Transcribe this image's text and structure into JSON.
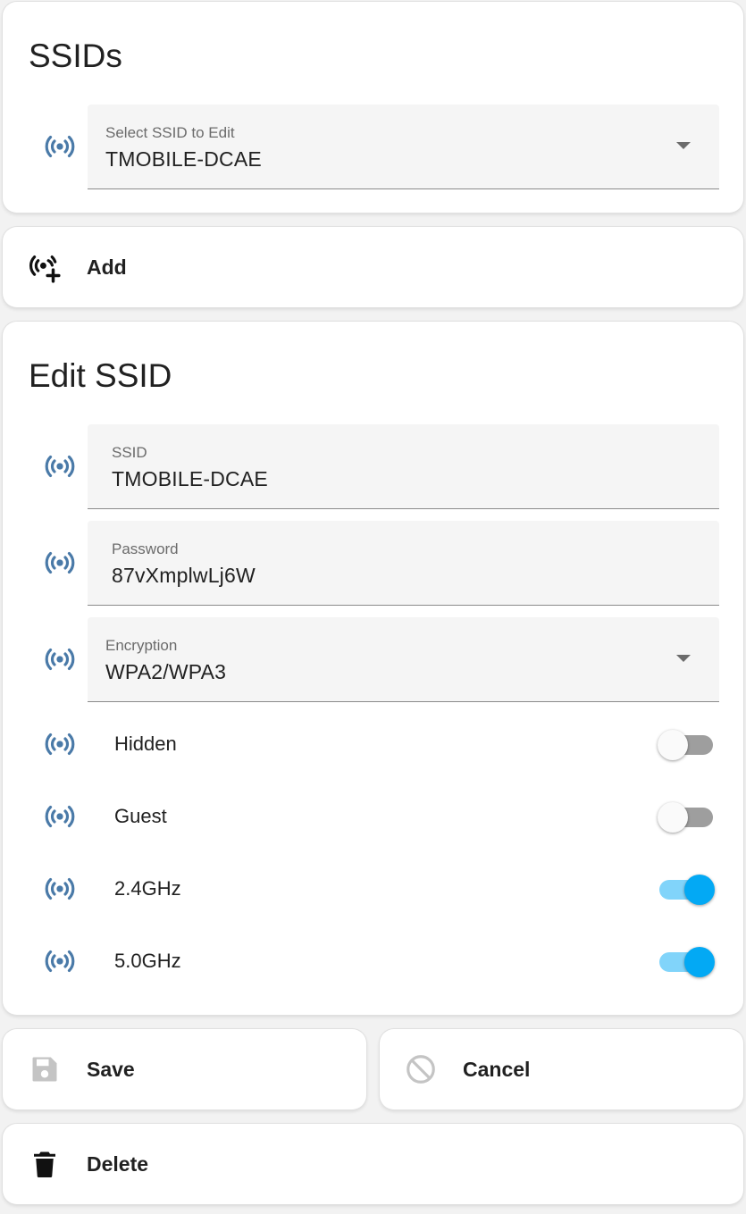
{
  "ssids_card": {
    "title": "SSIDs",
    "select": {
      "label": "Select SSID to Edit",
      "value": "TMOBILE-DCAE"
    }
  },
  "add_card": {
    "label": "Add"
  },
  "edit_card": {
    "title": "Edit SSID",
    "ssid": {
      "label": "SSID",
      "value": "TMOBILE-DCAE"
    },
    "password": {
      "label": "Password",
      "value": "87vXmplwLj6W"
    },
    "encryption": {
      "label": "Encryption",
      "value": "WPA2/WPA3"
    },
    "toggles": [
      {
        "label": "Hidden",
        "on": false
      },
      {
        "label": "Guest",
        "on": false
      },
      {
        "label": "2.4GHz",
        "on": true
      },
      {
        "label": "5.0GHz",
        "on": true
      }
    ]
  },
  "actions": {
    "save": "Save",
    "cancel": "Cancel",
    "delete": "Delete"
  },
  "colors": {
    "icon_blue": "#4a7aa8",
    "switch_on": "#03a9f4",
    "switch_track_on": "#81d4fa",
    "switch_track_off": "#9e9e9e"
  }
}
